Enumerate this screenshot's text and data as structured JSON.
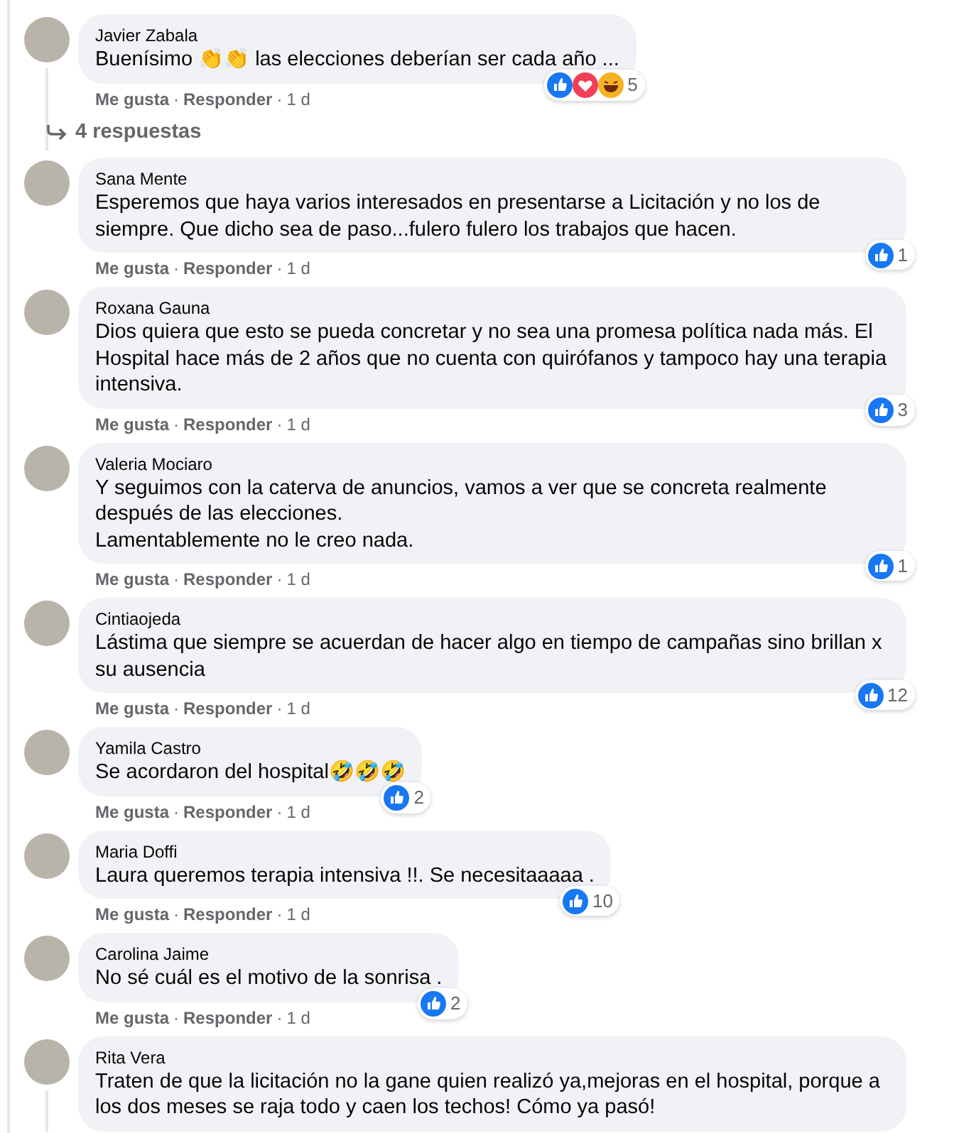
{
  "comments": [
    {
      "author": "Javier Zabala",
      "text": "Buenísimo 👏👏 las elecciones deberían ser cada año ...",
      "reactions": [
        {
          "kind": "like"
        },
        {
          "kind": "love"
        },
        {
          "kind": "haha"
        }
      ],
      "reaction_count": "5",
      "like": "Me gusta",
      "separator": "·",
      "reply": "Responder",
      "time": "1 d",
      "replies": "4 respuestas",
      "thread_line": true
    },
    {
      "author": "Sana Mente",
      "text": "Esperemos que haya varios interesados en presentarse a Licitación y no los de siempre. Que dicho sea de paso...fulero fulero los trabajos que hacen.",
      "reactions": [
        {
          "kind": "like"
        }
      ],
      "reaction_count": "1",
      "like": "Me gusta",
      "separator": "·",
      "reply": "Responder",
      "time": "1 d",
      "thread_line": false
    },
    {
      "author": "Roxana Gauna",
      "text": "Dios quiera que esto se pueda concretar y no sea una promesa política nada más. El Hospital hace más de 2 años que no cuenta con quirófanos y tampoco hay una terapia intensiva.",
      "reactions": [
        {
          "kind": "like"
        }
      ],
      "reaction_count": "3",
      "like": "Me gusta",
      "separator": "·",
      "reply": "Responder",
      "time": "1 d",
      "thread_line": false
    },
    {
      "author": "Valeria Mociaro",
      "text": "Y seguimos con la caterva de anuncios, vamos a ver que se concreta realmente después de las elecciones.\nLamentablemente no le creo nada.",
      "reactions": [
        {
          "kind": "like"
        }
      ],
      "reaction_count": "1",
      "like": "Me gusta",
      "separator": "·",
      "reply": "Responder",
      "time": "1 d",
      "thread_line": false
    },
    {
      "author": "Cintiaojeda",
      "text": "Lástima que siempre se acuerdan de hacer algo en tiempo de campañas sino brillan x su ausencia",
      "reactions": [
        {
          "kind": "like"
        }
      ],
      "reaction_count": "12",
      "like": "Me gusta",
      "separator": "·",
      "reply": "Responder",
      "time": "1 d",
      "thread_line": false
    },
    {
      "author": "Yamila Castro",
      "text": "Se acordaron del hospital🤣🤣🤣",
      "reactions": [
        {
          "kind": "like"
        }
      ],
      "reaction_count": "2",
      "like": "Me gusta",
      "separator": "·",
      "reply": "Responder",
      "time": "1 d",
      "thread_line": false
    },
    {
      "author": "Maria Doffi",
      "text": "Laura queremos terapia intensiva !!. Se necesitaaaaa .",
      "reactions": [
        {
          "kind": "like"
        }
      ],
      "reaction_count": "10",
      "like": "Me gusta",
      "separator": "·",
      "reply": "Responder",
      "time": "1 d",
      "thread_line": false
    },
    {
      "author": "Carolina Jaime",
      "text": "No sé cuál es el motivo de la sonrisa .",
      "reactions": [
        {
          "kind": "like"
        }
      ],
      "reaction_count": "2",
      "like": "Me gusta",
      "separator": "·",
      "reply": "Responder",
      "time": "1 d",
      "thread_line": false
    },
    {
      "author": "Rita Vera",
      "text": "Traten de que la licitación no la gane quien realizó ya,mejoras en el hospital, porque a los dos meses se raja todo y caen los techos! Cómo ya pasó!",
      "thread_line": true
    }
  ]
}
